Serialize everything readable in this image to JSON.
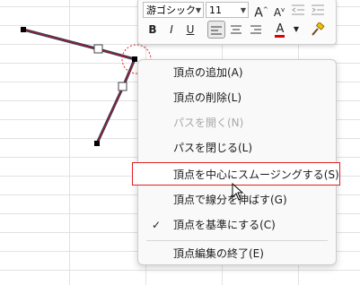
{
  "toolbar": {
    "font_name": "游ゴシック",
    "font_size": "11",
    "grow_font": "A",
    "shrink_font": "A",
    "bold": "B",
    "italic": "I",
    "underline": "U",
    "font_color": "A"
  },
  "context_menu": {
    "items": [
      {
        "label": "頂点の追加(A)",
        "enabled": true,
        "checked": false
      },
      {
        "label": "頂点の削除(L)",
        "enabled": true,
        "checked": false
      },
      {
        "label": "パスを開く(N)",
        "enabled": false,
        "checked": false
      },
      {
        "label": "パスを閉じる(L)",
        "enabled": true,
        "checked": false
      },
      {
        "label": "頂点を中心にスムージングする(S)",
        "enabled": true,
        "checked": false,
        "highlighted": true
      },
      {
        "label": "頂点で線分を伸ばす(G)",
        "enabled": true,
        "checked": false
      },
      {
        "label": "頂点を基準にする(C)",
        "enabled": true,
        "checked": true
      },
      {
        "label": "頂点編集の終了(E)",
        "enabled": true,
        "checked": false
      }
    ],
    "check_mark": "✓"
  },
  "colors": {
    "highlight_border": "#e02020",
    "shape_line_dark": "#2b3a55",
    "shape_line_red": "#c0152a",
    "font_color_bar": "#e00000"
  }
}
